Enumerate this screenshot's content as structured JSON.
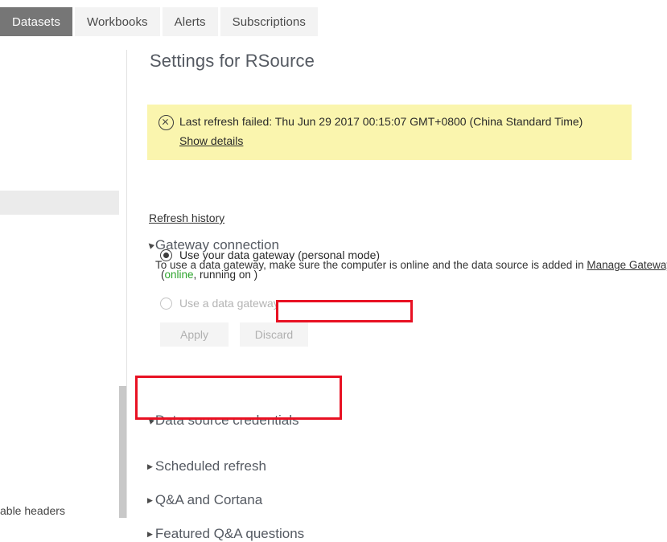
{
  "tabs": [
    {
      "label": "Datasets",
      "active": true
    },
    {
      "label": "Workbooks",
      "active": false
    },
    {
      "label": "Alerts",
      "active": false
    },
    {
      "label": "Subscriptions",
      "active": false
    }
  ],
  "left_pane": {
    "partial_text": "able headers"
  },
  "settings": {
    "title": "Settings for RSource",
    "banner": {
      "icon": "error-circle-x-icon",
      "message": "Last refresh failed: Thu Jun 29 2017 00:15:07 GMT+0800 (China Standard Time)",
      "details_link": "Show details",
      "background": "#faf5ae"
    },
    "refresh_history_link": "Refresh history",
    "gateway_section": {
      "title": "Gateway connection",
      "expanded": true,
      "description_before": "To use a data gateway, make sure the computer is online and the data source is added in ",
      "description_link": "Manage Gateways",
      "description_after": ".",
      "options": [
        {
          "label": "Use your data gateway (personal mode)",
          "selected": true,
          "disabled": false
        },
        {
          "label": "Use a data gateway",
          "selected": false,
          "disabled": true
        }
      ],
      "status": {
        "open_paren": "(",
        "state": "online",
        "state_color": "#2ea52e",
        "rest": ", running on )"
      },
      "apply_label": "Apply",
      "discard_label": "Discard"
    },
    "sections": [
      {
        "title": "Data source credentials",
        "expanded": true,
        "highlighted": true
      },
      {
        "title": "Scheduled refresh",
        "expanded": false,
        "highlighted": false
      },
      {
        "title": "Q&A and Cortana",
        "expanded": false,
        "highlighted": false
      },
      {
        "title": "Featured Q&A questions",
        "expanded": false,
        "highlighted": false
      }
    ]
  },
  "annotations": {
    "highlight_color": "#e81123"
  }
}
